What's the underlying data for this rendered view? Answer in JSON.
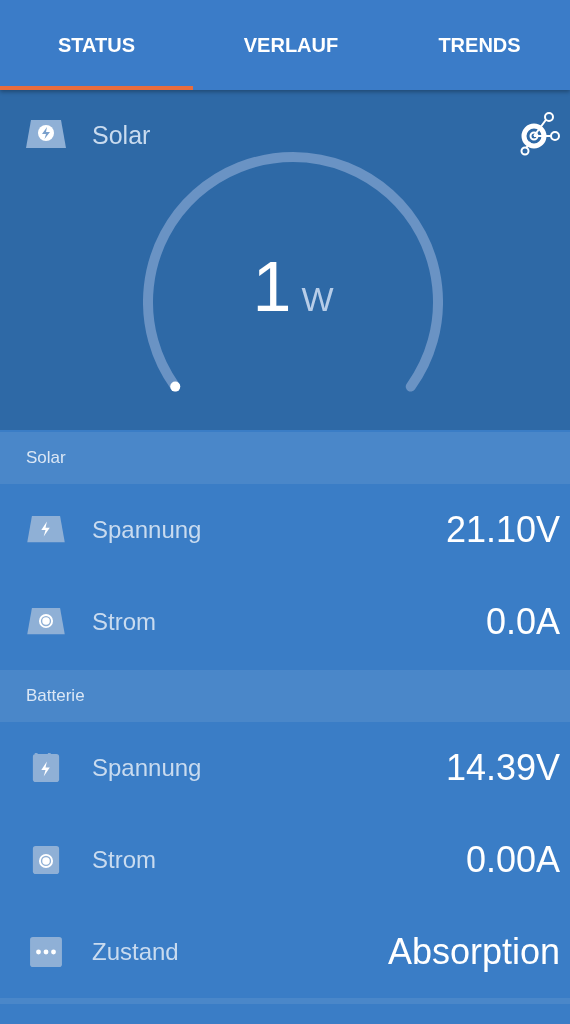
{
  "tabs": [
    {
      "label": "STATUS",
      "selected": true
    },
    {
      "label": "VERLAUF",
      "selected": false
    },
    {
      "label": "TRENDS",
      "selected": false
    }
  ],
  "hero": {
    "title": "Solar",
    "value": "1",
    "unit": "W"
  },
  "sections": [
    {
      "title": "Solar",
      "rows": [
        {
          "kind": "solar-bolt",
          "label": "Spannung",
          "value": "21.10V"
        },
        {
          "kind": "solar-dot",
          "label": "Strom",
          "value": "0.0A"
        }
      ]
    },
    {
      "title": "Batterie",
      "rows": [
        {
          "kind": "battery-bolt",
          "label": "Spannung",
          "value": "14.39V"
        },
        {
          "kind": "battery-dot",
          "label": "Strom",
          "value": "0.00A"
        },
        {
          "kind": "dots",
          "label": "Zustand",
          "value": "Absorption"
        }
      ]
    }
  ]
}
